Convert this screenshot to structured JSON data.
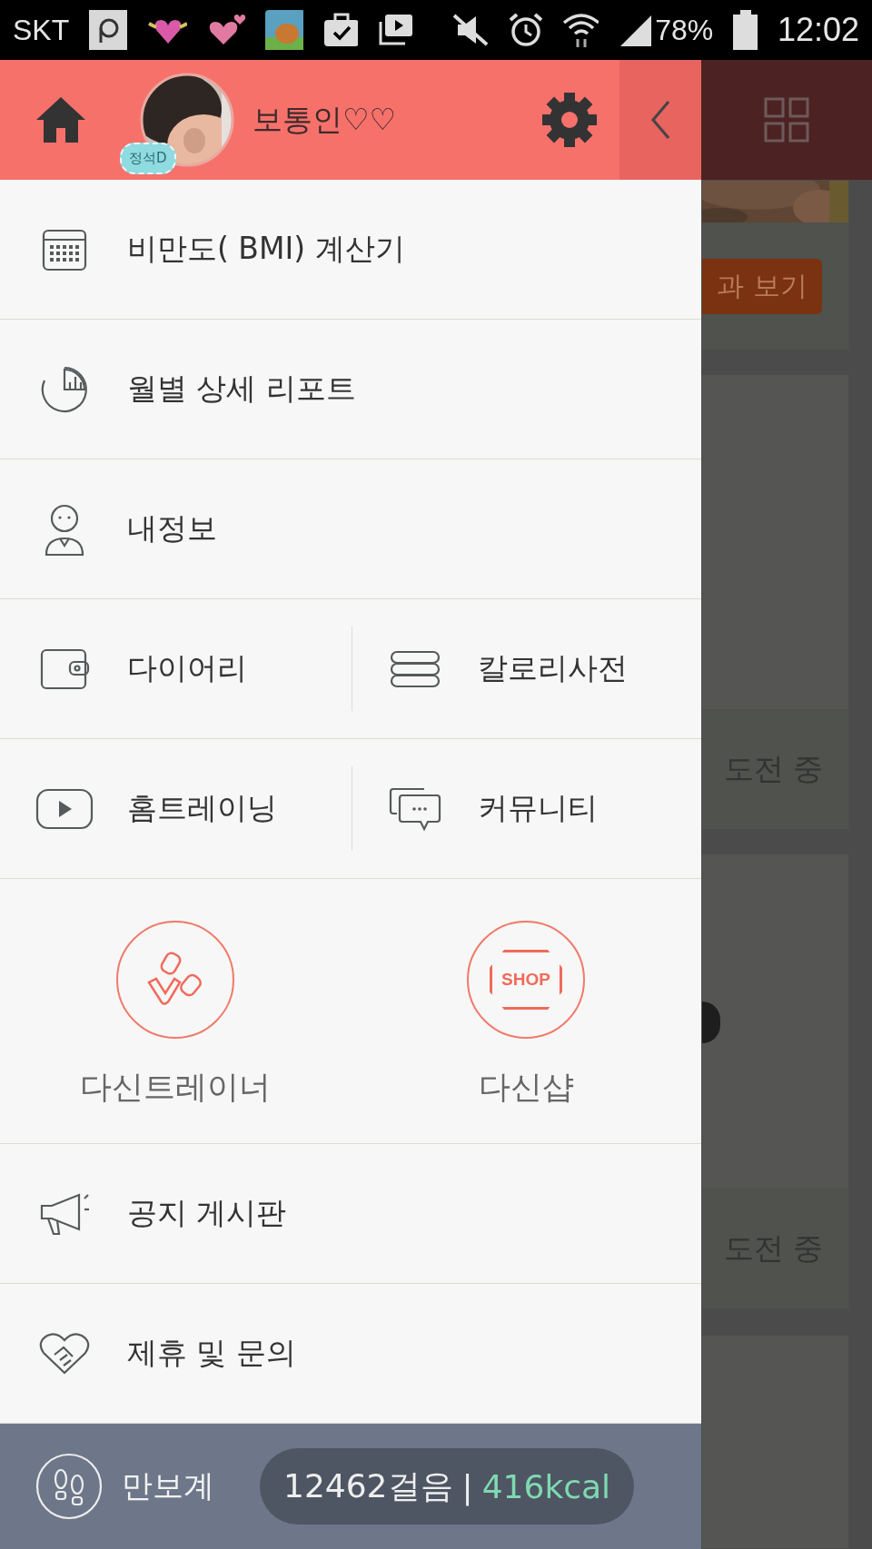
{
  "status_bar": {
    "carrier": "SKT",
    "battery": "78%",
    "time": "12:02"
  },
  "header": {
    "user_name": "보통인♡♡",
    "badge": "정석D"
  },
  "menu_top": [
    {
      "items": [
        {
          "label": "비만도( BMI) 계산기"
        }
      ]
    },
    {
      "items": [
        {
          "label": "월별 상세 리포트"
        }
      ]
    },
    {
      "items": [
        {
          "label": "내정보"
        }
      ]
    },
    {
      "items": [
        {
          "label": "다이어리"
        },
        {
          "label": "칼로리사전"
        }
      ]
    },
    {
      "items": [
        {
          "label": "홈트레이닝"
        },
        {
          "label": "커뮤니티"
        }
      ]
    }
  ],
  "features": [
    {
      "label": "다신트레이너"
    },
    {
      "label": "다신샵",
      "icon_text": "SHOP"
    }
  ],
  "menu_bottom": [
    {
      "items": [
        {
          "label": "공지 게시판"
        }
      ]
    },
    {
      "items": [
        {
          "label": "제휴 및 문의"
        }
      ]
    }
  ],
  "pedometer": {
    "label": "만보계",
    "steps": "12462걸음",
    "separator": "|",
    "calories": "416kcal"
  },
  "background": {
    "button": "과 보기",
    "captions": [
      "도전 중",
      "도전 중"
    ]
  }
}
